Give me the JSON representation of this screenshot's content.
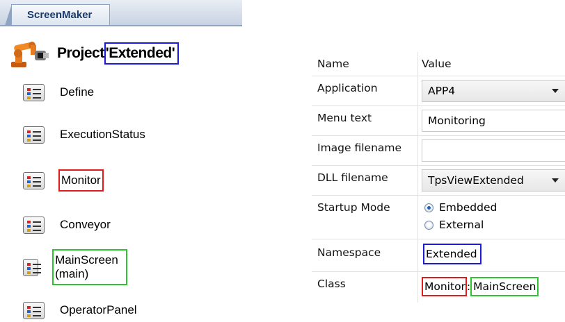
{
  "tab": {
    "label": "ScreenMaker"
  },
  "project": {
    "label": "Project",
    "name": "'Extended'"
  },
  "screens": [
    {
      "label": "Define"
    },
    {
      "label": "ExecutionStatus"
    },
    {
      "label": "Monitor"
    },
    {
      "label": "Conveyor"
    },
    {
      "label": "MainScreen (main)"
    },
    {
      "label": "OperatorPanel"
    }
  ],
  "properties": {
    "header": {
      "name": "Name",
      "value": "Value"
    },
    "application": {
      "name": "Application",
      "value": "APP4"
    },
    "menu_text": {
      "name": "Menu text",
      "value": "Monitoring"
    },
    "image_filename": {
      "name": "Image filename",
      "value": ""
    },
    "dll_filename": {
      "name": "DLL filename",
      "value": "TpsViewExtended"
    },
    "startup_mode": {
      "name": "Startup Mode",
      "options": [
        "Embedded",
        "External"
      ],
      "selected": "Embedded"
    },
    "namespace": {
      "name": "Namespace",
      "value": "Extended"
    },
    "class": {
      "name": "Class",
      "value_part1": "Monitor",
      "separator": ":",
      "value_part2": "MainScreen"
    }
  },
  "colors": {
    "highlight_red": "#e01b1b",
    "highlight_green": "#2ec42e",
    "highlight_blue": "#1a1ad8"
  }
}
